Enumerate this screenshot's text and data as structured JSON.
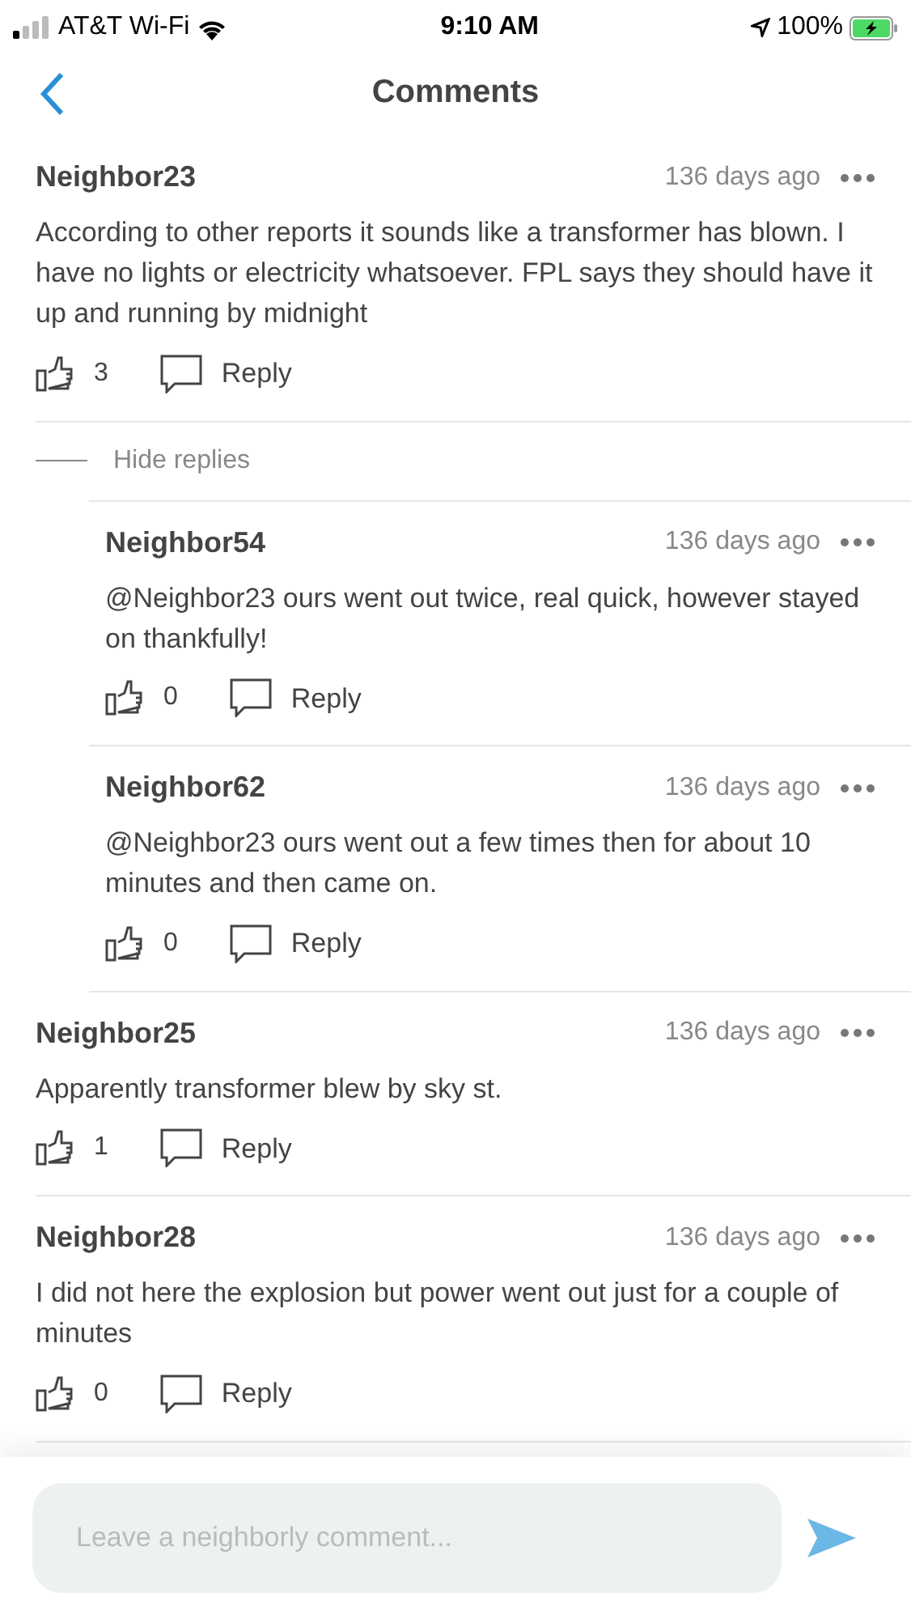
{
  "status_bar": {
    "carrier": "AT&T Wi-Fi",
    "time": "9:10 AM",
    "battery": "100%"
  },
  "header": {
    "title": "Comments"
  },
  "comments": [
    {
      "author": "Neighbor23",
      "time": "136 days ago",
      "text": "According to other reports it sounds like a transformer has blown. I have no lights or electricity whatsoever. FPL says they should have it up and running by midnight",
      "likes": "3",
      "reply": "Reply",
      "toggle": "Hide replies",
      "expanded": true,
      "children": [
        {
          "author": "Neighbor54",
          "time": "136 days ago",
          "text": "@Neighbor23  ours went out twice,  real quick, however stayed on thankfully!",
          "likes": "0",
          "reply": "Reply"
        },
        {
          "author": "Neighbor62",
          "time": "136 days ago",
          "text": "@Neighbor23 ours went out a few times then for about 10 minutes and then came on.",
          "likes": "0",
          "reply": "Reply"
        }
      ]
    },
    {
      "author": "Neighbor25",
      "time": "136 days ago",
      "text": "Apparently transformer blew by sky st.",
      "likes": "1",
      "reply": "Reply"
    },
    {
      "author": "Neighbor28",
      "time": "136 days ago",
      "text": "I did not here the explosion but power went out just for a couple of minutes",
      "likes": "0",
      "reply": "Reply"
    }
  ],
  "composer": {
    "placeholder": "Leave a neighborly comment..."
  }
}
